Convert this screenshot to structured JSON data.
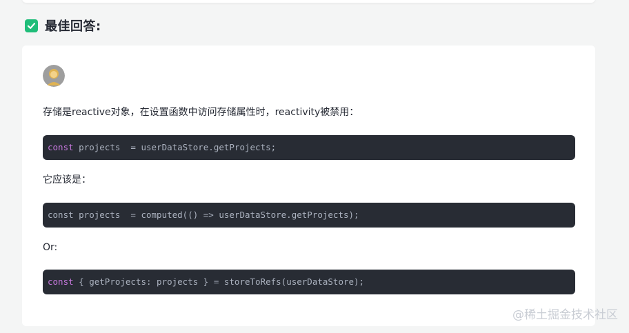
{
  "best_answer": {
    "title": "最佳回答:"
  },
  "answer": {
    "intro": "存储是reactive对象，在设置函数中访问存储属性时，reactivity被禁用：",
    "code1": {
      "keyword": "const",
      "rest": " projects  = userDataStore.getProjects;"
    },
    "middle": "它应该是：",
    "code2": {
      "text": "const projects  = computed(() => userDataStore.getProjects);"
    },
    "or_label": "Or:",
    "code3": {
      "keyword": "const",
      "rest": " { getProjects: projects } = storeToRefs(userDataStore);"
    }
  },
  "watermark": "@稀土掘金技术社区",
  "colors": {
    "check": "#1fbd79",
    "code_bg": "#282c34",
    "keyword": "#c678dd"
  },
  "icons": [
    "check-icon",
    "avatar"
  ]
}
